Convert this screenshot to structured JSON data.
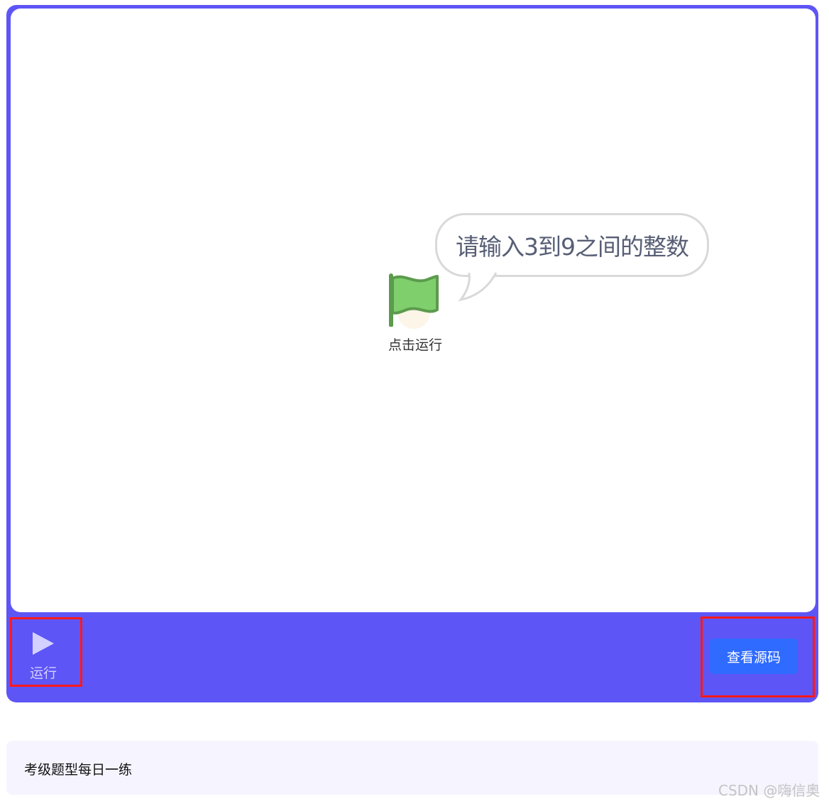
{
  "stage": {
    "speech_bubble": "请输入3到9之间的整数",
    "flag_label": "点击运行"
  },
  "controls": {
    "run_label": "运行",
    "view_source_label": "查看源码"
  },
  "footer": {
    "text": "考级题型每日一练"
  },
  "watermark": "CSDN @嗨信奥",
  "colors": {
    "player_frame": "#5e55f6",
    "primary_button": "#2f6bff",
    "highlight_box": "#ff1a1a",
    "flag_green": "#6cbf5f"
  }
}
